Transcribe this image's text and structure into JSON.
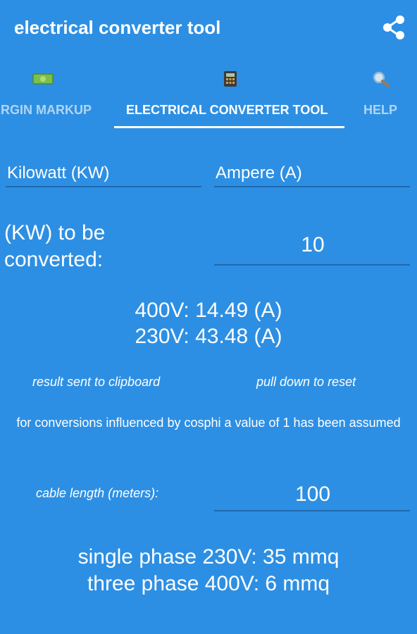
{
  "appbar": {
    "title": "electrical converter tool",
    "share_icon": "share-icon"
  },
  "tabs": [
    {
      "label": "ARGIN MARKUP",
      "icon": "money-icon",
      "selected": false
    },
    {
      "label": "ELECTRICAL CONVERTER TOOL",
      "icon": "calculator-icon",
      "selected": true
    },
    {
      "label": "HELP",
      "icon": "magnifier-icon",
      "selected": false
    }
  ],
  "converter": {
    "from_unit": "Kilowatt (KW)",
    "to_unit": "Ampere (A)",
    "input_label": "(KW) to be converted:",
    "input_value": "10",
    "result_400": "400V: 14.49 (A)",
    "result_230": "230V: 43.48 (A)",
    "clipboard_note": "result sent to clipboard",
    "reset_note": "pull down to reset",
    "cosphi_note": "for conversions influenced by cosphi a value of 1 has been assumed"
  },
  "cable": {
    "label": "cable length (meters):",
    "value": "100",
    "single_phase": "single phase 230V: 35 mmq",
    "three_phase": "three phase 400V: 6 mmq"
  },
  "colors": {
    "background": "#2D8FE3",
    "underline": "#1E69B0",
    "text": "#FFFFFF"
  }
}
